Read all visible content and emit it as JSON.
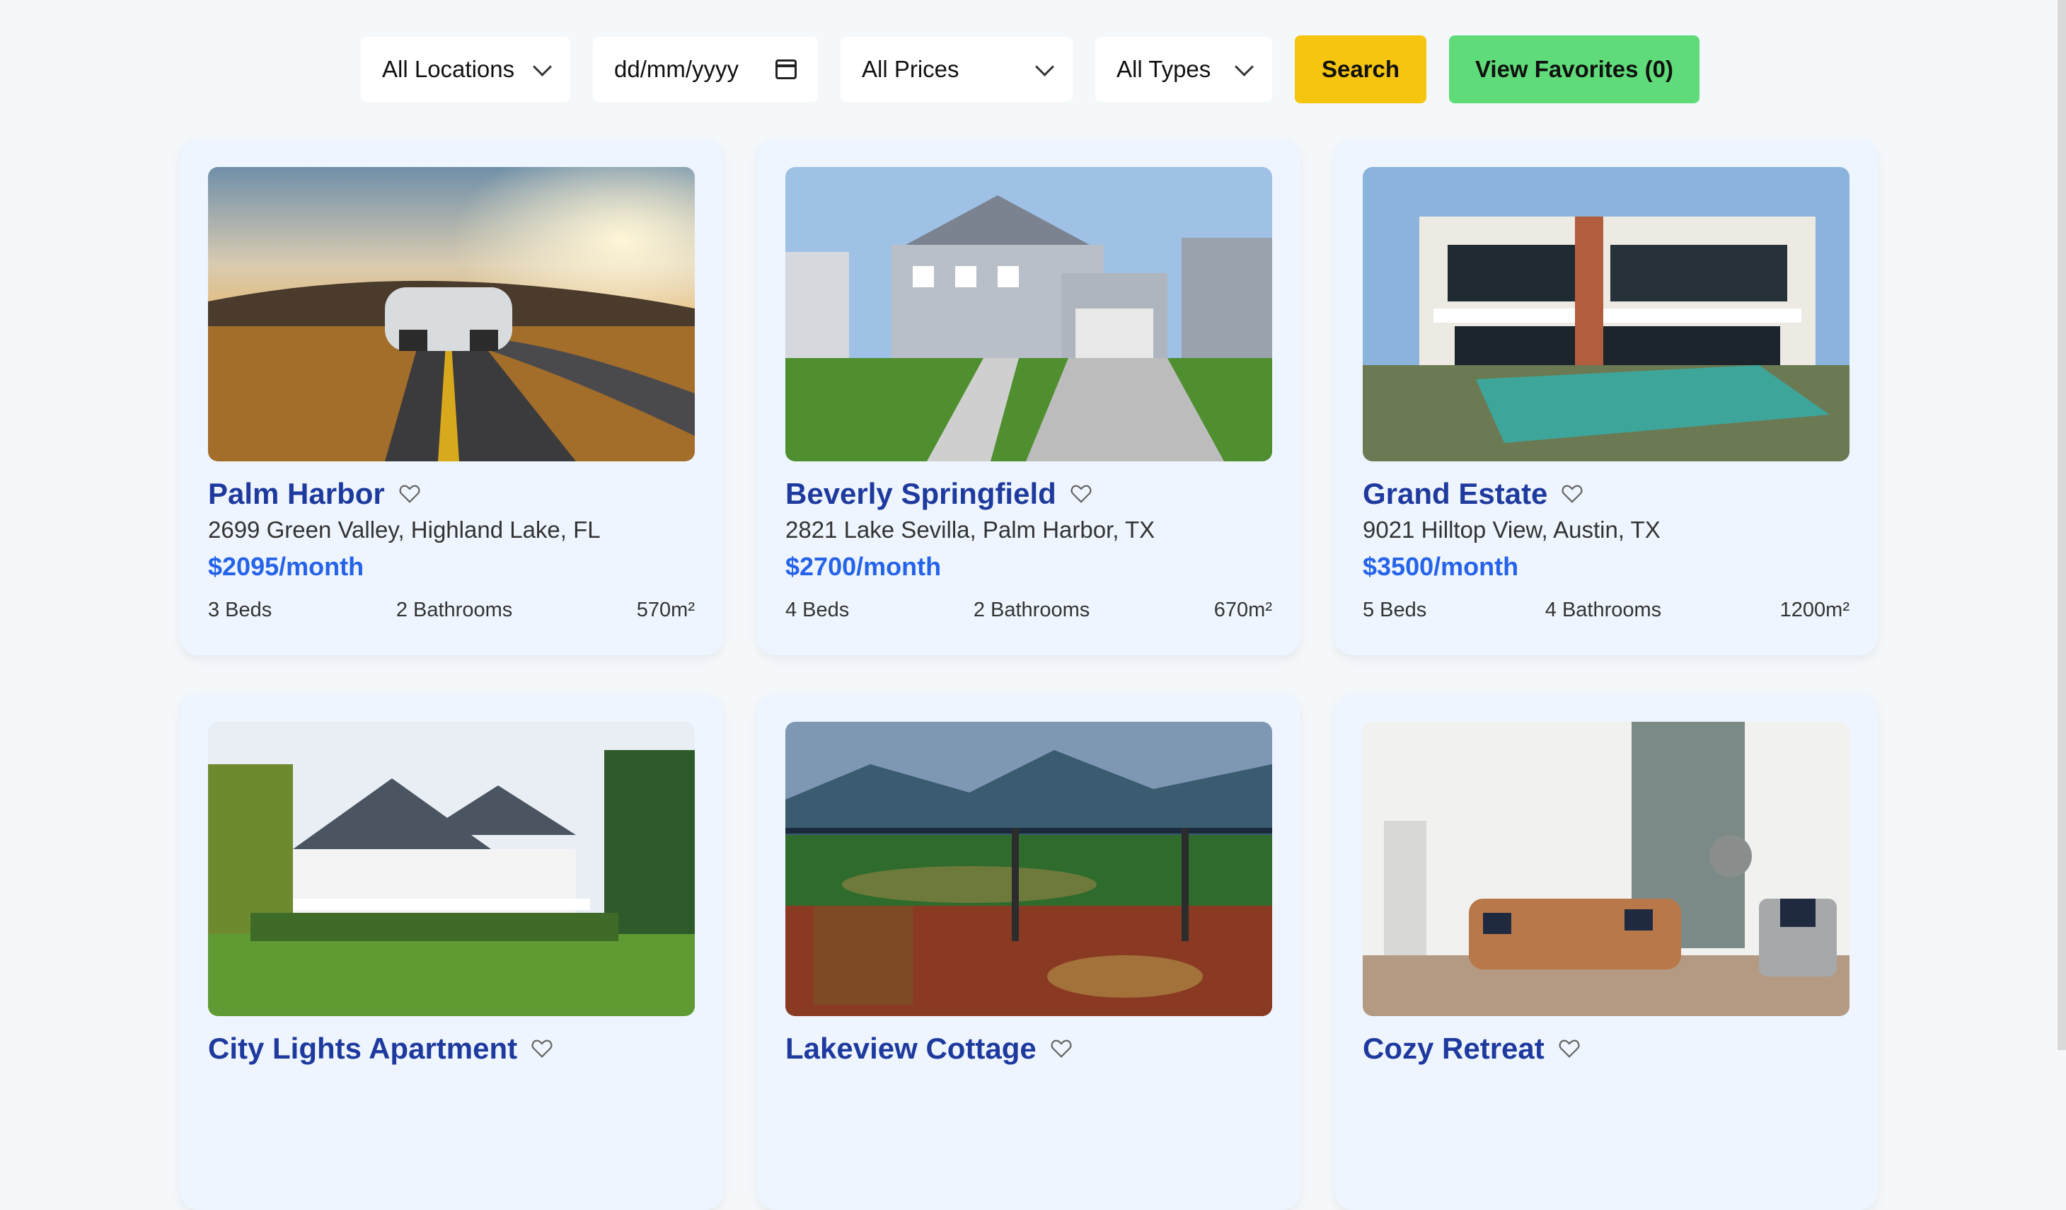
{
  "filters": {
    "location": "All Locations",
    "date_placeholder": "dd/mm/yyyy",
    "price": "All Prices",
    "type": "All Types",
    "search_label": "Search",
    "favorites_label": "View Favorites (0)"
  },
  "listings": [
    {
      "title": "Palm Harbor",
      "address": "2699 Green Valley, Highland Lake, FL",
      "price": "$2095/month",
      "beds": "3 Beds",
      "baths": "2 Bathrooms",
      "area": "570m²"
    },
    {
      "title": "Beverly Springfield",
      "address": "2821 Lake Sevilla, Palm Harbor, TX",
      "price": "$2700/month",
      "beds": "4 Beds",
      "baths": "2 Bathrooms",
      "area": "670m²"
    },
    {
      "title": "Grand Estate",
      "address": "9021 Hilltop View, Austin, TX",
      "price": "$3500/month",
      "beds": "5 Beds",
      "baths": "4 Bathrooms",
      "area": "1200m²"
    },
    {
      "title": "City Lights Apartment"
    },
    {
      "title": "Lakeview Cottage"
    },
    {
      "title": "Cozy Retreat"
    }
  ],
  "colors": {
    "accent_title": "#1e3a9e",
    "price": "#2563eb",
    "search_button": "#f6c510",
    "favorites_button": "#5fdc79"
  }
}
